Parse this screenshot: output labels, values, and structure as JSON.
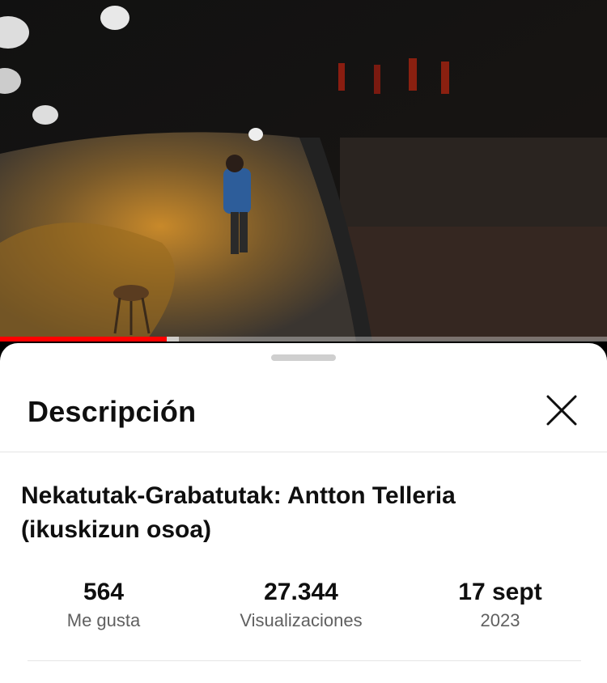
{
  "player": {
    "progress_fraction": 0.275,
    "buffered_fraction": 0.295,
    "accent_color": "#ff0000"
  },
  "sheet": {
    "title": "Descripción",
    "close_icon": "close-icon"
  },
  "video": {
    "title": "Nekatutak-Grabatutak: Antton Telleria (ikuskizun osoa)"
  },
  "stats": [
    {
      "value": "564",
      "label": "Me gusta"
    },
    {
      "value": "27.344",
      "label": "Visualizaciones"
    },
    {
      "value": "17 sept",
      "label": "2023"
    }
  ]
}
